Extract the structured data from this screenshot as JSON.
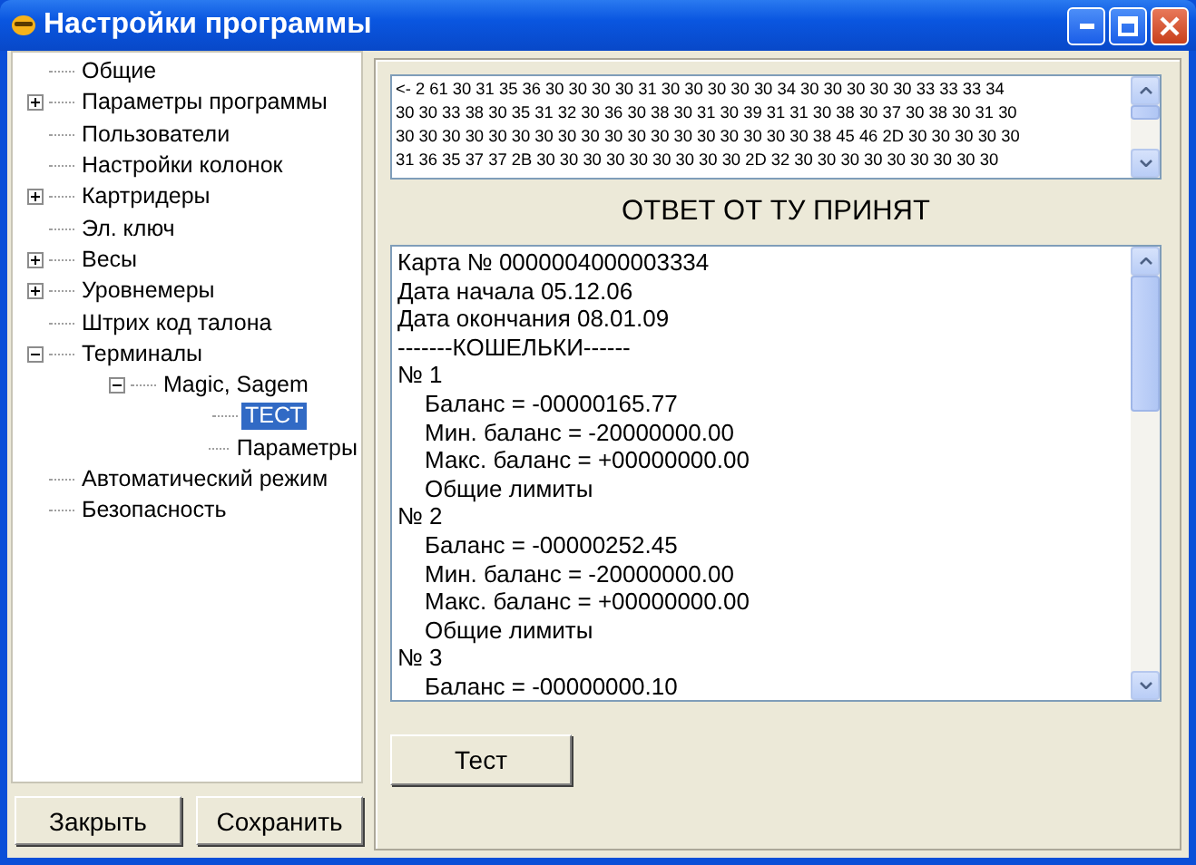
{
  "window": {
    "title": "Настройки программы"
  },
  "tree": [
    {
      "label": "Общие",
      "selected": false
    },
    {
      "label": "Параметры программы",
      "selected": false,
      "expanded": false
    },
    {
      "label": "Пользователи",
      "selected": false
    },
    {
      "label": "Настройки колонок",
      "selected": false
    },
    {
      "label": "Картридеры",
      "selected": false,
      "expanded": false
    },
    {
      "label": "Эл. ключ",
      "selected": false
    },
    {
      "label": "Весы",
      "selected": false,
      "expanded": false
    },
    {
      "label": "Уровнемеры",
      "selected": false,
      "expanded": false
    },
    {
      "label": "Штрих код талона",
      "selected": false
    },
    {
      "label": "Терминалы",
      "selected": false,
      "expanded": true,
      "children": [
        {
          "label": "Magic, Sagem",
          "selected": false,
          "expanded": true,
          "children": [
            {
              "label": "ТЕСТ",
              "selected": true
            },
            {
              "label": "Параметры",
              "selected": false
            }
          ]
        }
      ]
    },
    {
      "label": "Автоматический режим",
      "selected": false
    },
    {
      "label": "Безопасность",
      "selected": false
    }
  ],
  "left_buttons": [
    "Закрыть",
    "Сохранить"
  ],
  "hex_log": [
    "<- 2 61 30 31 35 36 30 30 30 30 31 30 30 30 30 30 34 30 30 30 30 30 33 33 33 34",
    "30 30 33 38 30 35 31 32 30 36 30 38 30 31 30 39 31 31 30 38 30 37 30 38 30 31 30",
    "30 30 30 30 30 30 30 30 30 30 30 30 30 30 30 30 30 30 38 45 46 2D 30 30 30 30 30",
    "31 36 35 37 37 2B 30 30 30 30 30 30 30 30 30 2D 32 30 30 30 30 30 30 30 30 30"
  ],
  "status_heading": "ОТВЕТ ОТ ТУ ПРИНЯТ",
  "response_lines": [
    {
      "text": "Карта № 0000004000003334",
      "indented": false
    },
    {
      "text": "Дата начала 05.12.06",
      "indented": false
    },
    {
      "text": "Дата окончания 08.01.09",
      "indented": false
    },
    {
      "text": "-------КОШЕЛЬКИ------",
      "indented": false
    },
    {
      "text": "№ 1",
      "indented": false
    },
    {
      "text": "Баланс = -00000165.77",
      "indented": true
    },
    {
      "text": "Мин. баланс = -20000000.00",
      "indented": true
    },
    {
      "text": "Макс. баланс = +00000000.00",
      "indented": true
    },
    {
      "text": "Общие лимиты",
      "indented": true
    },
    {
      "text": "№ 2",
      "indented": false
    },
    {
      "text": "Баланс = -00000252.45",
      "indented": true
    },
    {
      "text": "Мин. баланс = -20000000.00",
      "indented": true
    },
    {
      "text": "Макс. баланс = +00000000.00",
      "indented": true
    },
    {
      "text": "Общие лимиты",
      "indented": true
    },
    {
      "text": "№ 3",
      "indented": false
    },
    {
      "text": "Баланс = -00000000.10",
      "indented": true
    }
  ],
  "test_button": "Тест"
}
